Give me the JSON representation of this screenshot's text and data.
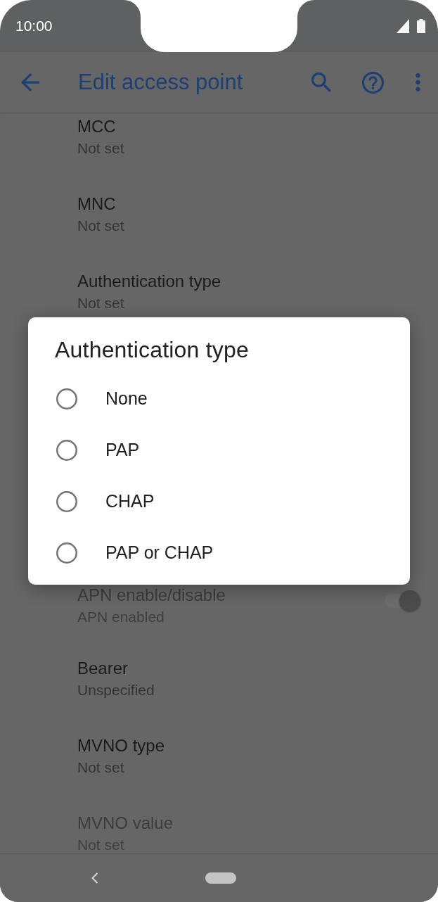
{
  "status_bar": {
    "time": "10:00"
  },
  "app_bar": {
    "title": "Edit access point"
  },
  "settings_above_dialog": [
    {
      "kind": "text",
      "title": "MCC",
      "summary": "Not set",
      "disabled": false
    },
    {
      "kind": "text",
      "title": "MNC",
      "summary": "Not set",
      "disabled": false
    },
    {
      "kind": "text",
      "title": "Authentication type",
      "summary": "Not set",
      "disabled": false
    }
  ],
  "dialog": {
    "title": "Authentication type",
    "options": [
      {
        "label": "None",
        "selected": false
      },
      {
        "label": "PAP",
        "selected": false
      },
      {
        "label": "CHAP",
        "selected": false
      },
      {
        "label": "PAP or CHAP",
        "selected": false
      }
    ]
  },
  "settings_below_dialog": [
    {
      "kind": "switch",
      "title": "APN enable/disable",
      "summary": "APN enabled",
      "disabled": true,
      "on": true
    },
    {
      "kind": "text",
      "title": "Bearer",
      "summary": "Unspecified",
      "disabled": false
    },
    {
      "kind": "text",
      "title": "MVNO type",
      "summary": "Not set",
      "disabled": false
    },
    {
      "kind": "text",
      "title": "MVNO value",
      "summary": "Not set",
      "disabled": true
    }
  ]
}
